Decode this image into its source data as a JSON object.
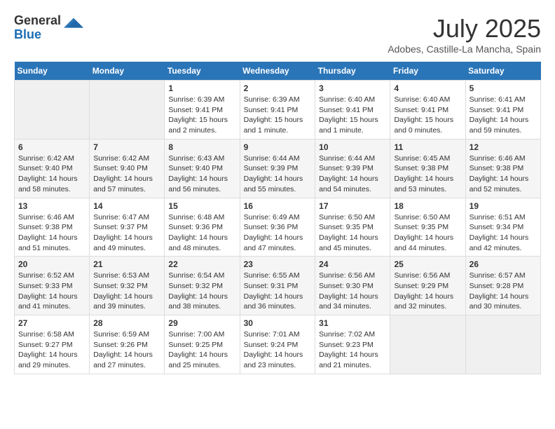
{
  "logo": {
    "general": "General",
    "blue": "Blue"
  },
  "title": "July 2025",
  "location": "Adobes, Castille-La Mancha, Spain",
  "weekdays": [
    "Sunday",
    "Monday",
    "Tuesday",
    "Wednesday",
    "Thursday",
    "Friday",
    "Saturday"
  ],
  "weeks": [
    [
      {
        "day": "",
        "empty": true
      },
      {
        "day": "",
        "empty": true
      },
      {
        "day": "1",
        "sunrise": "6:39 AM",
        "sunset": "9:41 PM",
        "daylight": "15 hours and 2 minutes."
      },
      {
        "day": "2",
        "sunrise": "6:39 AM",
        "sunset": "9:41 PM",
        "daylight": "15 hours and 1 minute."
      },
      {
        "day": "3",
        "sunrise": "6:40 AM",
        "sunset": "9:41 PM",
        "daylight": "15 hours and 1 minute."
      },
      {
        "day": "4",
        "sunrise": "6:40 AM",
        "sunset": "9:41 PM",
        "daylight": "15 hours and 0 minutes."
      },
      {
        "day": "5",
        "sunrise": "6:41 AM",
        "sunset": "9:41 PM",
        "daylight": "14 hours and 59 minutes."
      }
    ],
    [
      {
        "day": "6",
        "sunrise": "6:42 AM",
        "sunset": "9:40 PM",
        "daylight": "14 hours and 58 minutes."
      },
      {
        "day": "7",
        "sunrise": "6:42 AM",
        "sunset": "9:40 PM",
        "daylight": "14 hours and 57 minutes."
      },
      {
        "day": "8",
        "sunrise": "6:43 AM",
        "sunset": "9:40 PM",
        "daylight": "14 hours and 56 minutes."
      },
      {
        "day": "9",
        "sunrise": "6:44 AM",
        "sunset": "9:39 PM",
        "daylight": "14 hours and 55 minutes."
      },
      {
        "day": "10",
        "sunrise": "6:44 AM",
        "sunset": "9:39 PM",
        "daylight": "14 hours and 54 minutes."
      },
      {
        "day": "11",
        "sunrise": "6:45 AM",
        "sunset": "9:38 PM",
        "daylight": "14 hours and 53 minutes."
      },
      {
        "day": "12",
        "sunrise": "6:46 AM",
        "sunset": "9:38 PM",
        "daylight": "14 hours and 52 minutes."
      }
    ],
    [
      {
        "day": "13",
        "sunrise": "6:46 AM",
        "sunset": "9:38 PM",
        "daylight": "14 hours and 51 minutes."
      },
      {
        "day": "14",
        "sunrise": "6:47 AM",
        "sunset": "9:37 PM",
        "daylight": "14 hours and 49 minutes."
      },
      {
        "day": "15",
        "sunrise": "6:48 AM",
        "sunset": "9:36 PM",
        "daylight": "14 hours and 48 minutes."
      },
      {
        "day": "16",
        "sunrise": "6:49 AM",
        "sunset": "9:36 PM",
        "daylight": "14 hours and 47 minutes."
      },
      {
        "day": "17",
        "sunrise": "6:50 AM",
        "sunset": "9:35 PM",
        "daylight": "14 hours and 45 minutes."
      },
      {
        "day": "18",
        "sunrise": "6:50 AM",
        "sunset": "9:35 PM",
        "daylight": "14 hours and 44 minutes."
      },
      {
        "day": "19",
        "sunrise": "6:51 AM",
        "sunset": "9:34 PM",
        "daylight": "14 hours and 42 minutes."
      }
    ],
    [
      {
        "day": "20",
        "sunrise": "6:52 AM",
        "sunset": "9:33 PM",
        "daylight": "14 hours and 41 minutes."
      },
      {
        "day": "21",
        "sunrise": "6:53 AM",
        "sunset": "9:32 PM",
        "daylight": "14 hours and 39 minutes."
      },
      {
        "day": "22",
        "sunrise": "6:54 AM",
        "sunset": "9:32 PM",
        "daylight": "14 hours and 38 minutes."
      },
      {
        "day": "23",
        "sunrise": "6:55 AM",
        "sunset": "9:31 PM",
        "daylight": "14 hours and 36 minutes."
      },
      {
        "day": "24",
        "sunrise": "6:56 AM",
        "sunset": "9:30 PM",
        "daylight": "14 hours and 34 minutes."
      },
      {
        "day": "25",
        "sunrise": "6:56 AM",
        "sunset": "9:29 PM",
        "daylight": "14 hours and 32 minutes."
      },
      {
        "day": "26",
        "sunrise": "6:57 AM",
        "sunset": "9:28 PM",
        "daylight": "14 hours and 30 minutes."
      }
    ],
    [
      {
        "day": "27",
        "sunrise": "6:58 AM",
        "sunset": "9:27 PM",
        "daylight": "14 hours and 29 minutes."
      },
      {
        "day": "28",
        "sunrise": "6:59 AM",
        "sunset": "9:26 PM",
        "daylight": "14 hours and 27 minutes."
      },
      {
        "day": "29",
        "sunrise": "7:00 AM",
        "sunset": "9:25 PM",
        "daylight": "14 hours and 25 minutes."
      },
      {
        "day": "30",
        "sunrise": "7:01 AM",
        "sunset": "9:24 PM",
        "daylight": "14 hours and 23 minutes."
      },
      {
        "day": "31",
        "sunrise": "7:02 AM",
        "sunset": "9:23 PM",
        "daylight": "14 hours and 21 minutes."
      },
      {
        "day": "",
        "empty": true
      },
      {
        "day": "",
        "empty": true
      }
    ]
  ]
}
